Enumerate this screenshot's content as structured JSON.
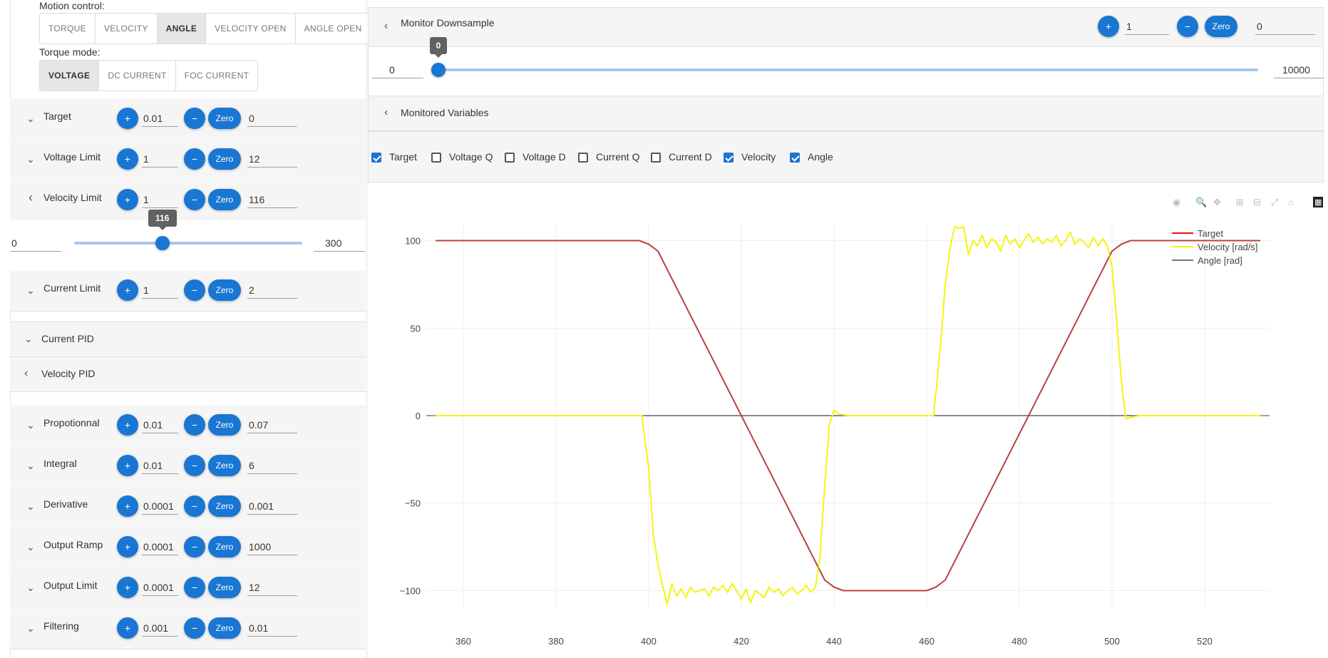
{
  "motion": {
    "label": "Motion control:",
    "options": [
      "TORQUE",
      "VELOCITY",
      "ANGLE",
      "VELOCITY OPEN",
      "ANGLE OPEN"
    ],
    "selected": "ANGLE"
  },
  "torque": {
    "label": "Torque mode:",
    "options": [
      "VOLTAGE",
      "DC CURRENT",
      "FOC CURRENT"
    ],
    "selected": "VOLTAGE"
  },
  "params": [
    {
      "label": "Target",
      "step": "0.01",
      "value": "0",
      "chev": "expand"
    },
    {
      "label": "Voltage Limit",
      "step": "1",
      "value": "12",
      "chev": "expand"
    },
    {
      "label": "Velocity Limit",
      "step": "1",
      "value": "116",
      "chev": "collapse"
    },
    {
      "label": "Current Limit",
      "step": "1",
      "value": "2",
      "chev": "expand"
    }
  ],
  "velocity_slider": {
    "min": "0",
    "max": "300",
    "value": 116,
    "tip": "116"
  },
  "current_pid": {
    "label": "Current PID"
  },
  "velocity_pid": {
    "label": "Velocity PID"
  },
  "pid_params": [
    {
      "label": "Propotionnal",
      "step": "0.01",
      "value": "0.07"
    },
    {
      "label": "Integral",
      "step": "0.01",
      "value": "6"
    },
    {
      "label": "Derivative",
      "step": "0.0001",
      "value": "0.001"
    },
    {
      "label": "Output Ramp",
      "step": "0.0001",
      "value": "1000"
    },
    {
      "label": "Output Limit",
      "step": "0.0001",
      "value": "12"
    },
    {
      "label": "Filtering",
      "step": "0.001",
      "value": "0.01"
    }
  ],
  "buttons": {
    "plus": "+",
    "minus": "−",
    "zero": "Zero"
  },
  "downsample": {
    "title": "Monitor Downsample",
    "step": "1",
    "value": "0",
    "slider_min": "0",
    "slider_max": "10000",
    "slider_value": 0,
    "tip": "0"
  },
  "monitored": {
    "title": "Monitored Variables",
    "vars": [
      {
        "label": "Target",
        "checked": true
      },
      {
        "label": "Voltage Q",
        "checked": false
      },
      {
        "label": "Voltage D",
        "checked": false
      },
      {
        "label": "Current Q",
        "checked": false
      },
      {
        "label": "Current D",
        "checked": false
      },
      {
        "label": "Velocity",
        "checked": true
      },
      {
        "label": "Angle",
        "checked": true
      }
    ]
  },
  "modebar_icons": [
    "camera-icon",
    "zoom-icon",
    "pan-icon",
    "zoom-in-icon",
    "zoom-out-icon",
    "autoscale-icon",
    "home-icon",
    "plotly-logo-icon"
  ],
  "chart_data": {
    "type": "line",
    "xlim": [
      352,
      534
    ],
    "ylim": [
      -110,
      110
    ],
    "xticks": [
      360,
      380,
      400,
      420,
      440,
      460,
      480,
      500,
      520
    ],
    "yticks": [
      100,
      50,
      0,
      -50,
      -100
    ],
    "ytick_labels": [
      "100",
      "50",
      "0",
      "−50",
      "−100"
    ],
    "grid": true,
    "legend_position": "top-right",
    "series": [
      {
        "name": "Target",
        "color": "#ee1111",
        "points": [
          [
            354,
            100
          ],
          [
            398,
            100
          ],
          [
            400,
            98
          ],
          [
            402,
            94
          ],
          [
            420,
            0
          ],
          [
            438,
            -94
          ],
          [
            440,
            -98
          ],
          [
            442,
            -100
          ],
          [
            460,
            -100
          ],
          [
            462,
            -98
          ],
          [
            464,
            -94
          ],
          [
            482,
            0
          ],
          [
            500,
            94
          ],
          [
            502,
            98
          ],
          [
            504,
            100
          ],
          [
            532,
            100
          ]
        ]
      },
      {
        "name": "Velocity [rad/s]",
        "color": "#f5f50a",
        "points": [
          [
            354,
            0
          ],
          [
            398.5,
            0
          ],
          [
            400,
            -30
          ],
          [
            401,
            -68
          ],
          [
            402,
            -85
          ],
          [
            403,
            -97
          ],
          [
            404,
            -108
          ],
          [
            405,
            -96
          ],
          [
            406,
            -103
          ],
          [
            407,
            -99
          ],
          [
            408,
            -104
          ],
          [
            409,
            -98
          ],
          [
            410,
            -101
          ],
          [
            411,
            -100
          ],
          [
            412,
            -99
          ],
          [
            413,
            -103
          ],
          [
            414,
            -98
          ],
          [
            415,
            -100
          ],
          [
            416,
            -97
          ],
          [
            417,
            -101
          ],
          [
            418,
            -96
          ],
          [
            419,
            -100
          ],
          [
            420,
            -105
          ],
          [
            421,
            -99
          ],
          [
            422,
            -107
          ],
          [
            423,
            -100
          ],
          [
            424,
            -102
          ],
          [
            425,
            -104
          ],
          [
            426,
            -98
          ],
          [
            427,
            -101
          ],
          [
            428,
            -99
          ],
          [
            429,
            -103
          ],
          [
            430,
            -100
          ],
          [
            431,
            -98
          ],
          [
            432,
            -102
          ],
          [
            433,
            -100
          ],
          [
            434,
            -97
          ],
          [
            435,
            -101
          ],
          [
            436,
            -98
          ],
          [
            437,
            -80
          ],
          [
            438,
            -40
          ],
          [
            439,
            -5
          ],
          [
            440,
            3
          ],
          [
            441,
            1
          ],
          [
            443,
            0
          ],
          [
            461.5,
            0
          ],
          [
            463,
            40
          ],
          [
            464,
            75
          ],
          [
            465,
            95
          ],
          [
            466,
            108
          ],
          [
            467,
            107
          ],
          [
            468,
            108
          ],
          [
            469,
            92
          ],
          [
            470,
            100
          ],
          [
            471,
            97
          ],
          [
            472,
            103
          ],
          [
            473,
            96
          ],
          [
            474,
            101
          ],
          [
            475,
            99
          ],
          [
            476,
            94
          ],
          [
            477,
            103
          ],
          [
            478,
            98
          ],
          [
            479,
            101
          ],
          [
            480,
            96
          ],
          [
            481,
            100
          ],
          [
            482,
            104
          ],
          [
            483,
            99
          ],
          [
            484,
            102
          ],
          [
            485,
            98
          ],
          [
            486,
            101
          ],
          [
            487,
            99
          ],
          [
            488,
            103
          ],
          [
            489,
            97
          ],
          [
            490,
            100
          ],
          [
            491,
            105
          ],
          [
            492,
            98
          ],
          [
            493,
            101
          ],
          [
            494,
            99
          ],
          [
            495,
            96
          ],
          [
            496,
            102
          ],
          [
            497,
            97
          ],
          [
            498,
            101
          ],
          [
            499,
            97
          ],
          [
            500,
            85
          ],
          [
            501,
            55
          ],
          [
            502,
            20
          ],
          [
            503,
            -2
          ],
          [
            504,
            -1
          ],
          [
            506,
            0
          ],
          [
            532,
            0
          ]
        ]
      },
      {
        "name": "Angle [rad]",
        "color": "#777777",
        "points": [
          [
            354,
            100
          ],
          [
            398,
            100
          ],
          [
            400,
            98
          ],
          [
            402,
            94
          ],
          [
            420,
            0
          ],
          [
            438,
            -94
          ],
          [
            440,
            -98
          ],
          [
            442,
            -100
          ],
          [
            460,
            -100
          ],
          [
            462,
            -98
          ],
          [
            464,
            -94
          ],
          [
            482,
            0
          ],
          [
            500,
            94
          ],
          [
            502,
            98
          ],
          [
            504,
            100
          ],
          [
            532,
            100
          ]
        ]
      },
      {
        "name": "",
        "color": "#777777",
        "points": [
          [
            399,
            0
          ],
          [
            532,
            0
          ]
        ]
      }
    ]
  }
}
